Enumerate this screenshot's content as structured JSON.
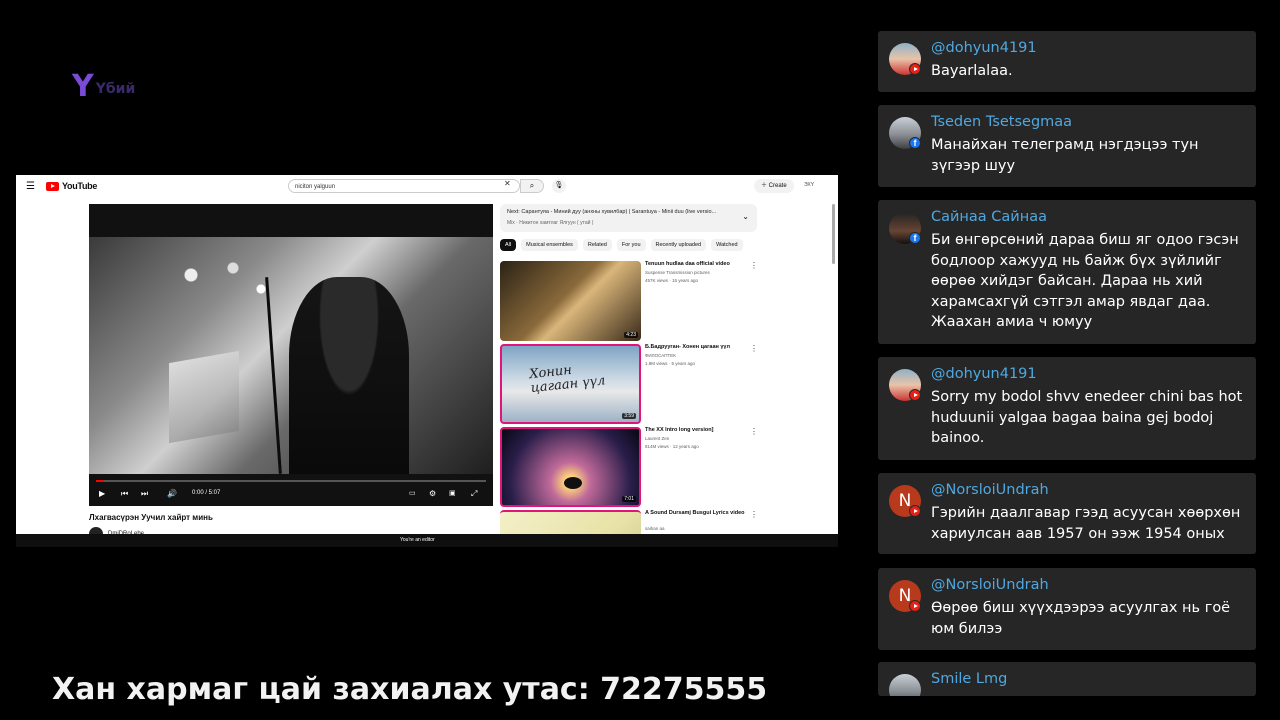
{
  "brand": {
    "mark": "Y",
    "name": "Yбий"
  },
  "youtube": {
    "logo_text": "YouTube",
    "search_value": "niciton yalguun",
    "create_label": "Create",
    "account_label": "ЭХY",
    "player": {
      "time": "0:00 / 5:07",
      "progress": 0.02
    },
    "video_title": "Лхагвасүрэн Уучил хайрт минь",
    "channel": "DmiDRoLebe",
    "editor_notice": "You're an editor",
    "next": {
      "label": "Next: Сарантуяа - Миний дуу (анхны хувилбар) | Sarantuya - Minii duu (live versio...",
      "sub": "Mix · Никитон хамтлаг Ялгуун ( утай )"
    },
    "chips": [
      "All",
      "Musical ensembles",
      "Related",
      "For you",
      "Recently uploaded",
      "Watched"
    ],
    "recommendations": [
      {
        "title": "Tenuun hudlaa daa official video",
        "channel": "Suspense Transmission pictures",
        "meta": "457K views · 15 years ago",
        "duration": "4:23"
      },
      {
        "title": "Б.Бадрууган- Хонен цагаан үүл",
        "channel": "ФИЛОСАПТЕК",
        "meta": "1.8M views · 5 years ago",
        "duration": "3:59",
        "thumb_text": "Хонин цагаан үүл"
      },
      {
        "title": "The XX   Intro long version]",
        "channel": "Laurent Zen",
        "meta": "814M views · 12 years ago",
        "duration": "7:01"
      },
      {
        "title": "A Sound   Dursamj Busgui Lyrics video",
        "channel": "saihan aa",
        "meta": "",
        "duration": ""
      }
    ]
  },
  "chat": [
    {
      "user": "@dohyun4191",
      "platform": "youtube",
      "avatar": "photo",
      "text": "Bayarlalaa."
    },
    {
      "user": "Tseden Tsetsegmaa",
      "platform": "facebook",
      "avatar": "photo2",
      "text": "Манайхан телеграмд нэгдэцээ тун зүгээр шуу"
    },
    {
      "user": "Сайнаа Сайнаа",
      "platform": "facebook",
      "avatar": "photo3",
      "text": "Би өнгөрсөний дараа биш яг одоо гэсэн бодлоор хажууд нь байж бүх зүйлийг өөрөө хийдэг байсан. Дараа нь хий харамсахгүй сэтгэл амар явдаг даа. Жаахан амиа ч юмуу"
    },
    {
      "user": "@dohyun4191",
      "platform": "youtube",
      "avatar": "photo",
      "text": "Sorry my bodol shvv enedeer chini bas hot huduunii yalgaa bagaa baina gej bodoj bainoo."
    },
    {
      "user": "@NorsloiUndrah",
      "platform": "youtube",
      "avatar": "N",
      "text": "Гэрийн даалгавар гээд асуусан хөөрхөн хариулсан аав 1957 он ээж 1954 оных"
    },
    {
      "user": "@NorsloiUndrah",
      "platform": "youtube",
      "avatar": "N",
      "text": "Өөрөө биш хүүхдээрээ асуулгах нь гоё юм билээ"
    },
    {
      "user": "Smile Lmg",
      "platform": "youtube",
      "avatar": "photo2",
      "text": ""
    }
  ],
  "banner": "Хан хармаг цай захиалах утас: 72275555",
  "colors": {
    "chat_bg": "#262626",
    "chat_user": "#4fa8e0",
    "youtube_red": "#ff0000",
    "facebook_blue": "#1877f2"
  }
}
